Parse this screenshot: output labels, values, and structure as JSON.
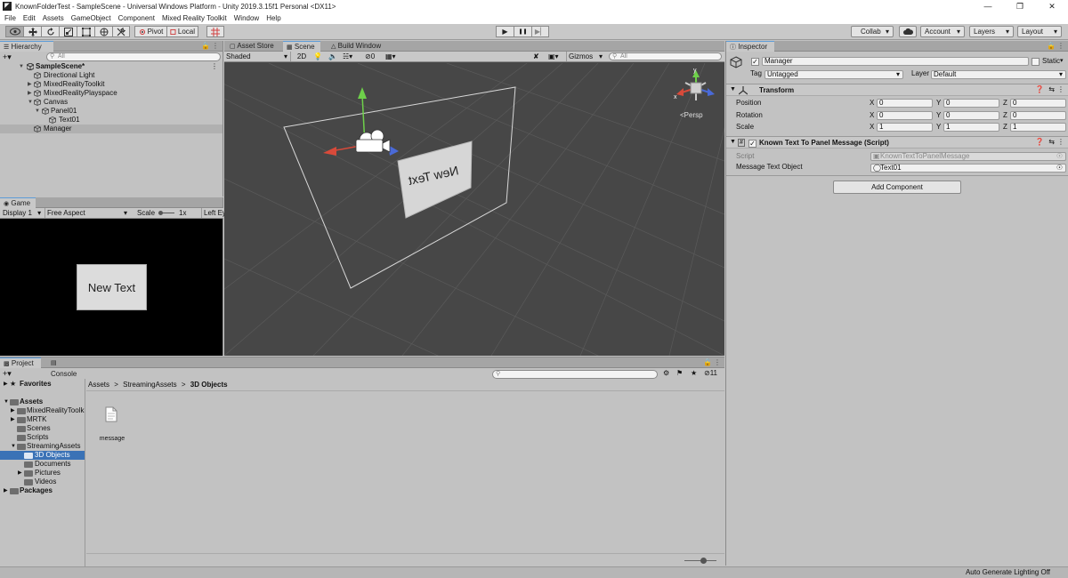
{
  "window": {
    "title": "KnownFolderTest - SampleScene - Universal Windows Platform - Unity 2019.3.15f1 Personal <DX11>",
    "icon_label": "◤",
    "controls": [
      "—",
      "❐",
      "✕"
    ]
  },
  "menu": [
    "File",
    "Edit",
    "Assets",
    "GameObject",
    "Component",
    "Mixed Reality Toolkit",
    "Window",
    "Help"
  ],
  "toolbar": {
    "tools": [
      "view-tool-icon",
      "move-tool-icon",
      "rotate-tool-icon",
      "scale-tool-icon",
      "rect-tool-icon",
      "transform-tool-icon",
      "custom-tool-icon"
    ],
    "pivot_label": "Pivot",
    "local_label": "Local",
    "play_controls": [
      "▶",
      "❚❚",
      "▶▏"
    ],
    "collab_label": "Collab",
    "account_label": "Account",
    "layers_label": "Layers",
    "layout_label": "Layout",
    "caret": "▾"
  },
  "hierarchy": {
    "tab_label": "Hierarchy",
    "search_placeholder": "All",
    "add_label": "+▾",
    "items": [
      {
        "label": "SampleScene*"
      },
      {
        "label": "Directional Light"
      },
      {
        "label": "MixedRealityToolkit"
      },
      {
        "label": "MixedRealityPlayspace"
      },
      {
        "label": "Canvas"
      },
      {
        "label": "Panel01"
      },
      {
        "label": "Text01"
      },
      {
        "label": "Manager"
      }
    ]
  },
  "scene_tabs": {
    "asset_store": "Asset Store",
    "scene": "Scene",
    "build_window": "Build Window"
  },
  "scene_toolbar": {
    "shading_mode": "Shaded",
    "mode_2d": "2D",
    "hidden_count": "0",
    "gizmos_label": "Gizmos",
    "search_placeholder": "All"
  },
  "scene_view": {
    "panel_text": "New Text",
    "persp_label": "<Persp",
    "axis_y": "y",
    "axis_x": "x"
  },
  "game": {
    "tab_label": "Game",
    "display_label": "Display 1",
    "aspect_label": "Free Aspect",
    "scale_label": "Scale",
    "scale_value": "1x",
    "left_eye_label": "Left Ey",
    "panel_text": "New Text"
  },
  "inspector": {
    "tab_label": "Inspector",
    "object_name": "Manager",
    "static_label": "Static",
    "tag_label": "Tag",
    "tag_value": "Untagged",
    "layer_label": "Layer",
    "layer_value": "Default",
    "transform_title": "Transform",
    "position_label": "Position",
    "rotation_label": "Rotation",
    "scale_label": "Scale",
    "position": {
      "x": "0",
      "y": "0",
      "z": "0"
    },
    "rotation": {
      "x": "0",
      "y": "0",
      "z": "0"
    },
    "scale": {
      "x": "1",
      "y": "1",
      "z": "1"
    },
    "axis_x": "X",
    "axis_y": "Y",
    "axis_z": "Z",
    "script_component_title": "Known Text To Panel Message (Script)",
    "script_label": "Script",
    "script_value": "KnownTextToPanelMessage",
    "message_label": "Message Text Object",
    "message_value": "Text01",
    "add_component_label": "Add Component"
  },
  "project": {
    "project_tab": "Project",
    "console_tab": "Console",
    "add_label": "+▾",
    "hidden_count": "11",
    "favorites_label": "Favorites",
    "tree": [
      {
        "label": "Assets"
      },
      {
        "label": "MixedRealityToolk"
      },
      {
        "label": "MRTK"
      },
      {
        "label": "Scenes"
      },
      {
        "label": "Scripts"
      },
      {
        "label": "StreamingAssets"
      },
      {
        "label": "3D Objects"
      },
      {
        "label": "Documents"
      },
      {
        "label": "Pictures"
      },
      {
        "label": "Videos"
      },
      {
        "label": "Packages"
      }
    ],
    "breadcrumb": [
      "Assets",
      "StreamingAssets",
      "3D Objects"
    ],
    "breadcrumb_sep": ">",
    "file_name": "message"
  },
  "status_bar": {
    "text": "Auto Generate Lighting Off"
  },
  "colors": {
    "scene_bg": "#474747",
    "selection_blue": "#3a72b6",
    "panel_bg": "#c2c2c2"
  }
}
